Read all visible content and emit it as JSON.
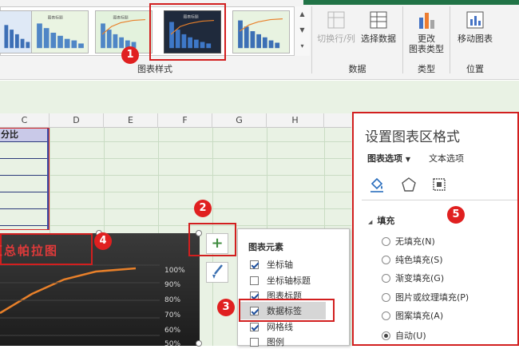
{
  "ribbon": {
    "groups": {
      "chart_styles": {
        "label": "图表样式"
      },
      "data": {
        "label": "数据",
        "switch_row_col": "切换行/列",
        "select_data": "选择数据"
      },
      "type": {
        "label": "类型",
        "change_type_line1": "更改",
        "change_type_line2": "图表类型"
      },
      "location": {
        "label": "位置",
        "move_chart": "移动图表"
      }
    }
  },
  "sheet": {
    "columns": [
      "C",
      "D",
      "E",
      "F",
      "G",
      "H"
    ],
    "cell_c1": "分比"
  },
  "chart": {
    "title_overlay": "汇总帕拉图",
    "title_visible_fragment": "汇总帕拉图",
    "axis_pcts": [
      "100%",
      "90%",
      "80%",
      "70%",
      "60%",
      "50%"
    ]
  },
  "chart_elements_popup": {
    "title": "图表元素",
    "items": [
      {
        "label": "坐标轴",
        "checked": true
      },
      {
        "label": "坐标轴标题",
        "checked": false
      },
      {
        "label": "图表标题",
        "checked": true
      },
      {
        "label": "数据标签",
        "checked": true
      },
      {
        "label": "网格线",
        "checked": true
      },
      {
        "label": "图例",
        "checked": false
      }
    ]
  },
  "format_pane": {
    "title": "设置图表区格式",
    "tab_chart_options": "图表选项",
    "tab_text_options": "文本选项",
    "section_fill": "填充",
    "fill_options": [
      {
        "label": "无填充(N)",
        "selected": false
      },
      {
        "label": "纯色填充(S)",
        "selected": false
      },
      {
        "label": "渐变填充(G)",
        "selected": false
      },
      {
        "label": "图片或纹理填充(P)",
        "selected": false
      },
      {
        "label": "图案填充(A)",
        "selected": false
      },
      {
        "label": "自动(U)",
        "selected": true
      }
    ]
  },
  "badges": [
    "1",
    "2",
    "3",
    "4",
    "5"
  ],
  "colors": {
    "accent_red": "#d21f1f",
    "badge_red": "#e02020",
    "excel_green": "#217346"
  }
}
